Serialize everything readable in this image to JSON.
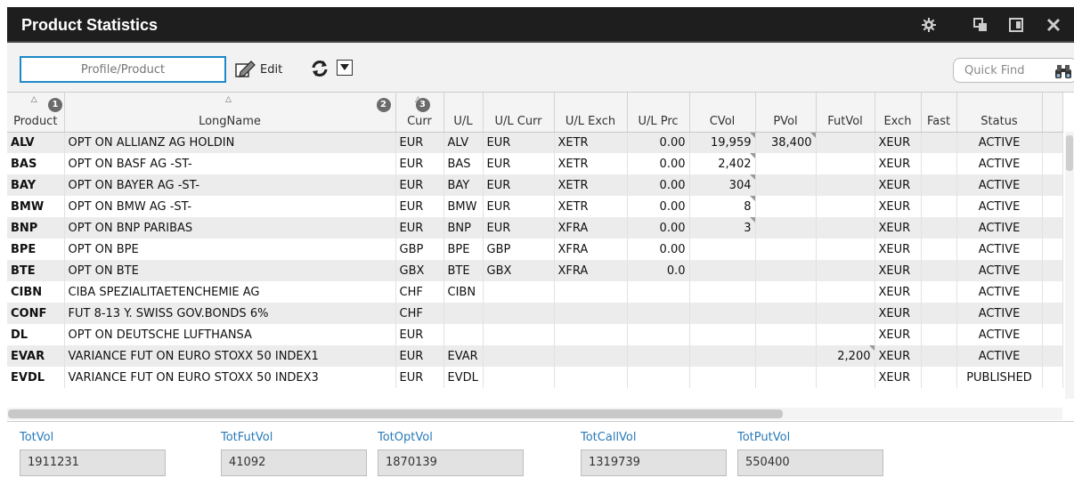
{
  "window": {
    "title": "Product Statistics"
  },
  "toolbar": {
    "search_placeholder": "Profile/Product",
    "edit_label": "Edit",
    "quickfind_label": "Quick Find"
  },
  "columns": [
    {
      "label": "Product",
      "badge": "1"
    },
    {
      "label": "LongName",
      "badge": "2"
    },
    {
      "label": "Curr",
      "badge": "3"
    },
    {
      "label": "U/L"
    },
    {
      "label": "U/L Curr"
    },
    {
      "label": "U/L Exch"
    },
    {
      "label": "U/L Prc"
    },
    {
      "label": "CVol"
    },
    {
      "label": "PVol"
    },
    {
      "label": "FutVol"
    },
    {
      "label": "Exch"
    },
    {
      "label": "Fast"
    },
    {
      "label": "Status"
    }
  ],
  "rows": [
    {
      "product": "ALV",
      "longname": "OPT ON ALLIANZ AG HOLDIN",
      "curr": "EUR",
      "ul": "ALV",
      "ul_curr": "EUR",
      "ul_exch": "XETR",
      "ul_prc": "0.00",
      "cvol": "19,959",
      "pvol": "38,400",
      "futvol": "",
      "exch": "XEUR",
      "fast": "",
      "status": "ACTIVE"
    },
    {
      "product": "BAS",
      "longname": "OPT ON BASF AG -ST-",
      "curr": "EUR",
      "ul": "BAS",
      "ul_curr": "EUR",
      "ul_exch": "XETR",
      "ul_prc": "0.00",
      "cvol": "2,402",
      "pvol": "",
      "futvol": "",
      "exch": "XEUR",
      "fast": "",
      "status": "ACTIVE"
    },
    {
      "product": "BAY",
      "longname": "OPT ON BAYER AG -ST-",
      "curr": "EUR",
      "ul": "BAY",
      "ul_curr": "EUR",
      "ul_exch": "XETR",
      "ul_prc": "0.00",
      "cvol": "304",
      "pvol": "",
      "futvol": "",
      "exch": "XEUR",
      "fast": "",
      "status": "ACTIVE"
    },
    {
      "product": "BMW",
      "longname": "OPT ON BMW AG -ST-",
      "curr": "EUR",
      "ul": "BMW",
      "ul_curr": "EUR",
      "ul_exch": "XETR",
      "ul_prc": "0.00",
      "cvol": "8",
      "pvol": "",
      "futvol": "",
      "exch": "XEUR",
      "fast": "",
      "status": "ACTIVE"
    },
    {
      "product": "BNP",
      "longname": "OPT ON BNP PARIBAS",
      "curr": "EUR",
      "ul": "BNP",
      "ul_curr": "EUR",
      "ul_exch": "XFRA",
      "ul_prc": "0.00",
      "cvol": "3",
      "pvol": "",
      "futvol": "",
      "exch": "XEUR",
      "fast": "",
      "status": "ACTIVE"
    },
    {
      "product": "BPE",
      "longname": "OPT ON BPE",
      "curr": "GBP",
      "ul": "BPE",
      "ul_curr": "GBP",
      "ul_exch": "XFRA",
      "ul_prc": "0.00",
      "cvol": "",
      "pvol": "",
      "futvol": "",
      "exch": "XEUR",
      "fast": "",
      "status": "ACTIVE"
    },
    {
      "product": "BTE",
      "longname": "OPT ON BTE",
      "curr": "GBX",
      "ul": "BTE",
      "ul_curr": "GBX",
      "ul_exch": "XFRA",
      "ul_prc": "0.0",
      "cvol": "",
      "pvol": "",
      "futvol": "",
      "exch": "XEUR",
      "fast": "",
      "status": "ACTIVE"
    },
    {
      "product": "CIBN",
      "longname": "CIBA SPEZIALITAETENCHEMIE AG",
      "curr": "CHF",
      "ul": "CIBN",
      "ul_curr": "",
      "ul_exch": "",
      "ul_prc": "",
      "cvol": "",
      "pvol": "",
      "futvol": "",
      "exch": "XEUR",
      "fast": "",
      "status": "ACTIVE"
    },
    {
      "product": "CONF",
      "longname": "FUT 8-13 Y. SWISS GOV.BONDS 6%",
      "curr": "CHF",
      "ul": "",
      "ul_curr": "",
      "ul_exch": "",
      "ul_prc": "",
      "cvol": "",
      "pvol": "",
      "futvol": "",
      "exch": "XEUR",
      "fast": "",
      "status": "ACTIVE"
    },
    {
      "product": "DL",
      "longname": "OPT ON DEUTSCHE LUFTHANSA",
      "curr": "EUR",
      "ul": "",
      "ul_curr": "",
      "ul_exch": "",
      "ul_prc": "",
      "cvol": "",
      "pvol": "",
      "futvol": "",
      "exch": "XEUR",
      "fast": "",
      "status": "ACTIVE"
    },
    {
      "product": "EVAR",
      "longname": "VARIANCE FUT ON EURO STOXX 50 INDEX1",
      "curr": "EUR",
      "ul": "EVAR",
      "ul_curr": "",
      "ul_exch": "",
      "ul_prc": "",
      "cvol": "",
      "pvol": "",
      "futvol": "2,200",
      "exch": "XEUR",
      "fast": "",
      "status": "ACTIVE"
    },
    {
      "product": "EVDL",
      "longname": "VARIANCE FUT ON EURO STOXX 50 INDEX3",
      "curr": "EUR",
      "ul": "EVDL",
      "ul_curr": "",
      "ul_exch": "",
      "ul_prc": "",
      "cvol": "",
      "pvol": "",
      "futvol": "",
      "exch": "XEUR",
      "fast": "",
      "status": "PUBLISHED"
    }
  ],
  "totals": [
    {
      "label": "TotVol",
      "value": "1911231"
    },
    {
      "label": "TotFutVol",
      "value": "41092"
    },
    {
      "label": "TotOptVol",
      "value": "1870139"
    },
    {
      "label": "TotCallVol",
      "value": "1319739"
    },
    {
      "label": "TotPutVol",
      "value": "550400"
    }
  ]
}
